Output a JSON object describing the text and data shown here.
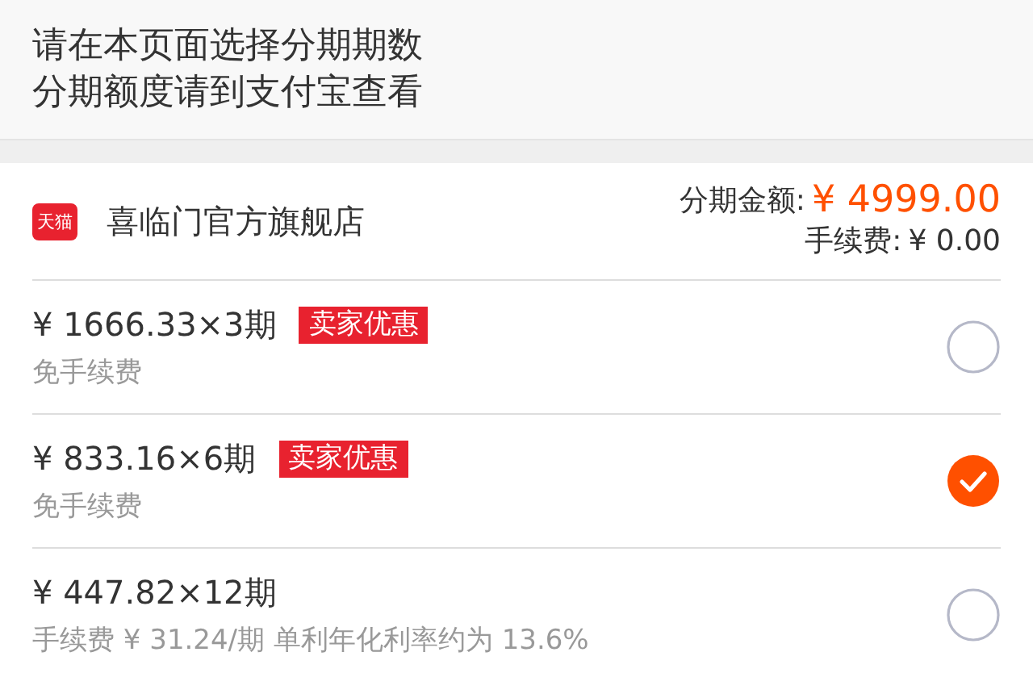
{
  "notice": {
    "lines": [
      "请在本页面选择分期期数",
      "分期额度请到支付宝查看"
    ]
  },
  "store": {
    "logo_text": "天猫",
    "name": "喜临门官方旗舰店",
    "amount_label": "分期金额:",
    "amount": "¥ 4999.00",
    "fee_label": "手续费:",
    "fee": "¥ 0.00"
  },
  "plans": [
    {
      "title": "¥ 1666.33×3期",
      "badge": "卖家优惠",
      "note": "免手续费",
      "selected": false
    },
    {
      "title": "¥ 833.16×6期",
      "badge": "卖家优惠",
      "note": "免手续费",
      "selected": true
    },
    {
      "title": "¥ 447.82×12期",
      "note": "手续费 ¥ 31.24/期 单利年化利率约为 13.6%",
      "selected": false
    }
  ]
}
